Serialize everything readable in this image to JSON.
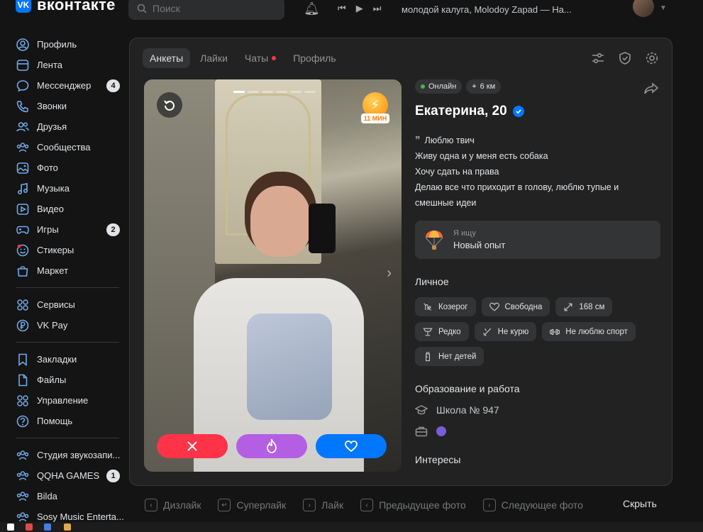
{
  "header": {
    "logo_text": "вконтакте",
    "search_placeholder": "Поиск",
    "now_playing": "молодой калуга, Molodoy Zapad — На..."
  },
  "sidebar": {
    "group1": [
      {
        "label": "Профиль",
        "icon": "profile-icon"
      },
      {
        "label": "Лента",
        "icon": "feed-icon"
      },
      {
        "label": "Мессенджер",
        "icon": "messenger-icon",
        "count": "4"
      },
      {
        "label": "Звонки",
        "icon": "phone-icon"
      },
      {
        "label": "Друзья",
        "icon": "friends-icon"
      },
      {
        "label": "Сообщества",
        "icon": "communities-icon"
      },
      {
        "label": "Фото",
        "icon": "photo-icon"
      },
      {
        "label": "Музыка",
        "icon": "music-icon"
      },
      {
        "label": "Видео",
        "icon": "video-icon"
      },
      {
        "label": "Игры",
        "icon": "games-icon",
        "count": "2"
      },
      {
        "label": "Стикеры",
        "icon": "stickers-icon"
      },
      {
        "label": "Маркет",
        "icon": "market-icon"
      }
    ],
    "group2": [
      {
        "label": "Сервисы",
        "icon": "services-icon"
      },
      {
        "label": "VK Pay",
        "icon": "vkpay-icon"
      }
    ],
    "group3": [
      {
        "label": "Закладки",
        "icon": "bookmark-icon"
      },
      {
        "label": "Файлы",
        "icon": "file-icon"
      },
      {
        "label": "Управление",
        "icon": "manage-icon"
      },
      {
        "label": "Помощь",
        "icon": "help-icon"
      }
    ],
    "group4": [
      {
        "label": "Студия звукозапи...",
        "icon": "group-icon"
      },
      {
        "label": "QQHA GAMES",
        "icon": "group-icon",
        "count": "1"
      },
      {
        "label": "Bilda",
        "icon": "group-icon"
      },
      {
        "label": "Sosy Music Enterta...",
        "icon": "group-icon"
      }
    ]
  },
  "tabs": [
    {
      "label": "Анкеты",
      "active": true
    },
    {
      "label": "Лайки",
      "active": false
    },
    {
      "label": "Чаты",
      "active": false,
      "dot": true
    },
    {
      "label": "Профиль",
      "active": false
    }
  ],
  "photo": {
    "boost_label": "11 МИН",
    "photo_count": 6,
    "current_photo": 1
  },
  "profile": {
    "online": "Онлайн",
    "distance": "6 км",
    "name": "Екатерина, 20",
    "bio": [
      "Люблю твич",
      "Живу одна и у меня есть собака",
      "Хочу сдать на права",
      "Делаю все что приходит в голову, люблю тупые и",
      "смешные идеи"
    ],
    "seeking_title": "Я ищу",
    "seeking_value": "Новый опыт",
    "personal_heading": "Личное",
    "tags": [
      {
        "label": "Козерог",
        "icon": "zodiac-icon"
      },
      {
        "label": "Свободна",
        "icon": "heart-icon"
      },
      {
        "label": "168 см",
        "icon": "height-icon"
      },
      {
        "label": "Редко",
        "icon": "drink-icon"
      },
      {
        "label": "Не курю",
        "icon": "no-smoking-icon"
      },
      {
        "label": "Не люблю спорт",
        "icon": "dumbbell-icon"
      },
      {
        "label": "Нет детей",
        "icon": "baby-bottle-icon"
      }
    ],
    "education_heading": "Образование и работа",
    "school": "Школа № 947",
    "interests_heading": "Интересы"
  },
  "footer": {
    "items": [
      {
        "key": "‹",
        "label": "Дизлайк"
      },
      {
        "key": "↵",
        "label": "Суперлайк"
      },
      {
        "key": "›",
        "label": "Лайк"
      },
      {
        "key": "‹",
        "label": "Предыдущее фото"
      },
      {
        "key": "›",
        "label": "Следующее фото"
      }
    ],
    "hide_label": "Скрыть"
  },
  "colors": {
    "accent": "#0077ff",
    "dislike": "#ff3347",
    "superlike": "#b45fe3",
    "like": "#0077ff",
    "online": "#4bb34b",
    "background": "#141414",
    "panel": "#222222"
  }
}
